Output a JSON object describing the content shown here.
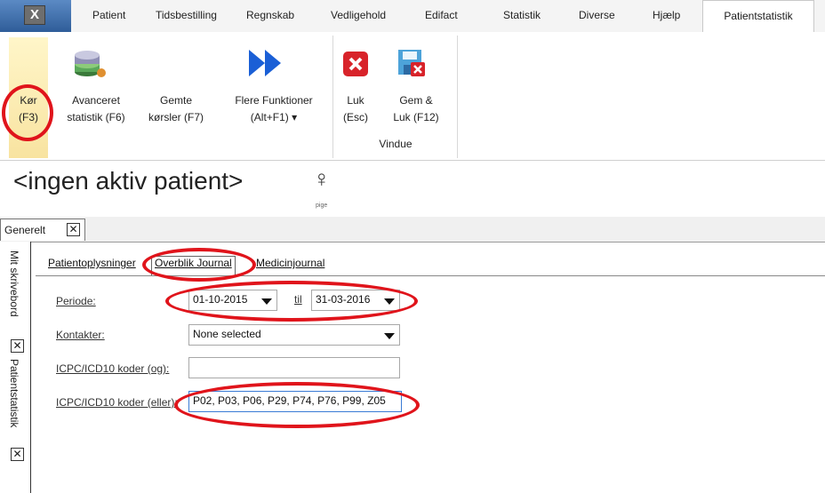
{
  "menu": {
    "app_button": "X",
    "items": [
      "Patient",
      "Tidsbestilling",
      "Regnskab",
      "Vedligehold",
      "Edifact",
      "Statistik",
      "Diverse",
      "Hjælp"
    ],
    "active_tab": "Patientstatistik"
  },
  "ribbon": {
    "kor": {
      "line1": "Kør",
      "line2": "(F3)"
    },
    "avanceret": {
      "line1": "Avanceret",
      "line2": "statistik (F6)"
    },
    "gemte": {
      "line1": "Gemte",
      "line2": "kørsler (F7)"
    },
    "flere": {
      "line1": "Flere Funktioner",
      "line2": "(Alt+F1)",
      "arrow": "▾"
    },
    "luk": {
      "line1": "Luk",
      "line2": "(Esc)"
    },
    "gemluk": {
      "line1": "Gem &",
      "line2": "Luk (F12)"
    },
    "vindue_group": "Vindue"
  },
  "patient": {
    "title": "<ingen aktiv patient>",
    "gender_symbol": "♀",
    "gender_label": "pige"
  },
  "tabs": {
    "generelt": "Generelt",
    "close": "✕"
  },
  "sidebar": {
    "mit_skrivebord": "Mit skrivebord",
    "patientstatistik": "Patientstatistik",
    "close": "✕"
  },
  "subtabs": [
    "Patientoplysninger",
    "Overblik Journal",
    "Medicinjournal"
  ],
  "form": {
    "periode_label": "Periode:",
    "periode_from": "01-10-2015",
    "til_label": "til",
    "periode_to": "31-03-2016",
    "kontakter_label": "Kontakter:",
    "kontakter_value": "None selected",
    "icpc_og_label": "ICPC/ICD10 koder (og):",
    "icpc_og_value": "",
    "icpc_eller_label": "ICPC/ICD10 koder (eller):",
    "icpc_eller_value": "P02, P03, P06, P29, P74, P76, P99, Z05"
  },
  "colors": {
    "highlight_ring": "#e0141b",
    "kor_bg": "#f8e3a0"
  }
}
